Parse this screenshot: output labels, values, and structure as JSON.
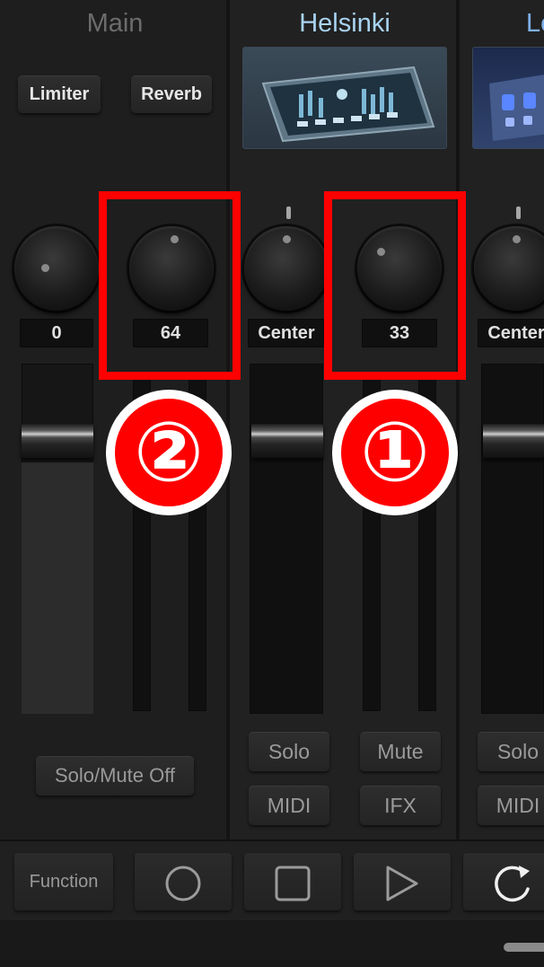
{
  "channels": {
    "main": {
      "title": "Main",
      "buttons": {
        "limiter": "Limiter",
        "reverb": "Reverb"
      },
      "knobs": [
        {
          "value": "0"
        },
        {
          "value": "64"
        }
      ],
      "solo_mute_off": "Solo/Mute Off"
    },
    "helsinki": {
      "title": "Helsinki",
      "knobs": [
        {
          "value": "Center"
        },
        {
          "value": "33"
        }
      ],
      "buttons": {
        "solo": "Solo",
        "mute": "Mute",
        "midi": "MIDI",
        "ifx": "IFX"
      }
    },
    "third": {
      "title": "Lo",
      "knobs": [
        {
          "value": "Center"
        }
      ],
      "buttons": {
        "solo": "Solo",
        "midi": "MIDI"
      }
    }
  },
  "annotations": {
    "badge_1": "①",
    "badge_2": "②",
    "highlight_color": "#ff0000"
  },
  "transport": {
    "function": "Function",
    "icons": [
      "record-icon",
      "stop-icon",
      "play-icon",
      "loop-icon"
    ]
  },
  "colors": {
    "helsinki_title": "#a9d4f2",
    "main_title": "#6c6c6c",
    "background": "#1c1c1c"
  }
}
